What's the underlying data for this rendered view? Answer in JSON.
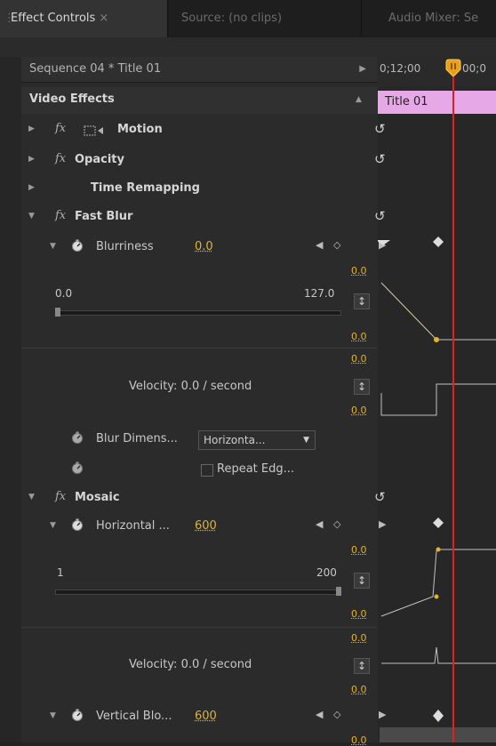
{
  "tabs": {
    "effect_controls": "Effect Controls",
    "effect_close": "×",
    "source": "Source: (no clips)",
    "audio_mixer": "Audio Mixer: Se"
  },
  "sequence": {
    "label": "Sequence 04 * Title 01"
  },
  "timeline": {
    "tc1": "0;12;00",
    "tc2": "00;0",
    "clip_name": "Title 01"
  },
  "video_effects": {
    "label": "Video Effects"
  },
  "effects": {
    "motion": "Motion",
    "opacity": "Opacity",
    "time_remapping": "Time Remapping",
    "fast_blur": "Fast Blur",
    "mosaic": "Mosaic"
  },
  "blurriness": {
    "label": "Blurriness",
    "value": "0.0",
    "range_min": "0.0",
    "range_max": "127.0",
    "graph_top": "0.0",
    "graph_bottom": "0.0",
    "velocity_top": "0.0",
    "velocity_bottom": "0.0",
    "velocity_text": "Velocity: 0.0 / second"
  },
  "blur_dimension": {
    "label": "Blur Dimens...",
    "value": "Horizonta..."
  },
  "repeat_edge": {
    "label": "Repeat Edg..."
  },
  "horizontal_blocks": {
    "label": "Horizontal ...",
    "value": "600",
    "range_min": "1",
    "range_max": "200",
    "graph_top": "0.0",
    "graph_bottom": "0.0",
    "velocity_top": "0.0",
    "velocity_bottom": "0.0",
    "velocity_text": "Velocity: 0.0 / second"
  },
  "vertical_blocks": {
    "label": "Vertical Blo...",
    "value": "600",
    "graph_top": "0.0"
  },
  "colors": {
    "accent_yellow": "#e0b42c",
    "clip_pink": "#e6a8e6",
    "playhead_red": "#e02020"
  }
}
